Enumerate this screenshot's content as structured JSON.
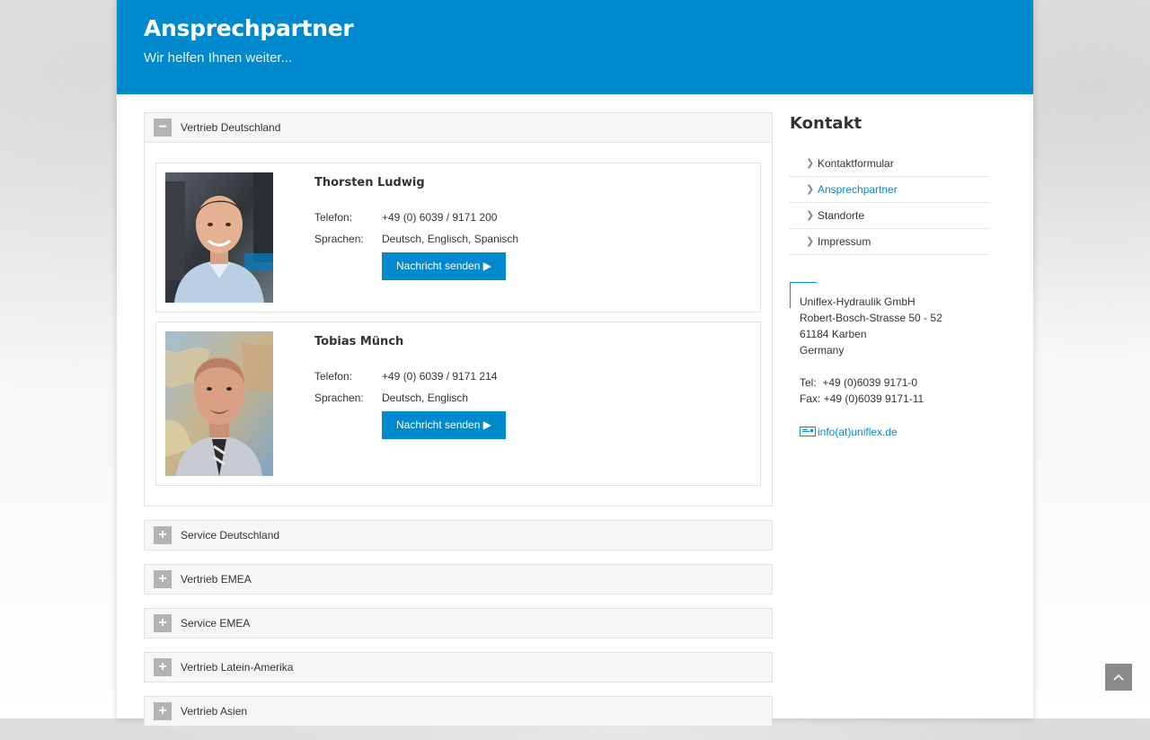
{
  "header": {
    "title": "Ansprechpartner",
    "subtitle": "Wir helfen Ihnen weiter..."
  },
  "accordion": {
    "open_section": {
      "title": "Vertrieb Deutschland",
      "toggle": "−",
      "people": [
        {
          "name": "Thorsten Ludwig",
          "phone_label": "Telefon:",
          "phone": "+49 (0) 6039 / 9171 200",
          "lang_label": "Sprachen:",
          "languages": "Deutsch, Englisch, Spanisch",
          "button": "Nachricht senden ▶"
        },
        {
          "name": "Tobias Münch",
          "phone_label": "Telefon:",
          "phone": "+49 (0) 6039 / 9171 214",
          "lang_label": "Sprachen:",
          "languages": "Deutsch, Englisch",
          "button": "Nachricht senden ▶"
        }
      ]
    },
    "closed_sections": [
      {
        "title": "Service Deutschland",
        "toggle": "+"
      },
      {
        "title": "Vertrieb EMEA",
        "toggle": "+"
      },
      {
        "title": "Service EMEA",
        "toggle": "+"
      },
      {
        "title": "Vertrieb Latein-Amerika",
        "toggle": "+"
      },
      {
        "title": "Vertrieb Asien",
        "toggle": "+"
      }
    ]
  },
  "sidebar": {
    "title": "Kontakt",
    "nav": [
      {
        "label": "Kontaktformular",
        "active": false
      },
      {
        "label": "Ansprechpartner",
        "active": true
      },
      {
        "label": "Standorte",
        "active": false
      },
      {
        "label": "Impressum",
        "active": false
      }
    ],
    "address": {
      "company": "Uniflex-Hydraulik GmbH",
      "street": "Robert-Bosch-Strasse 50 - 52",
      "city": "61184 Karben",
      "country": "Germany",
      "tel": "Tel:  +49 (0)6039 9171-0",
      "fax": "Fax: +49 (0)6039 9171-11",
      "email": "info(at)uniflex.de"
    }
  },
  "icons": {
    "chevron": "chevron-right-icon",
    "mail": "mail-icon",
    "to_top": "arrow-up-icon"
  },
  "colors": {
    "brand_blue": "#0089cc",
    "toggle_gray": "#b3b3b3",
    "totop_gray": "#8a8a8a"
  }
}
